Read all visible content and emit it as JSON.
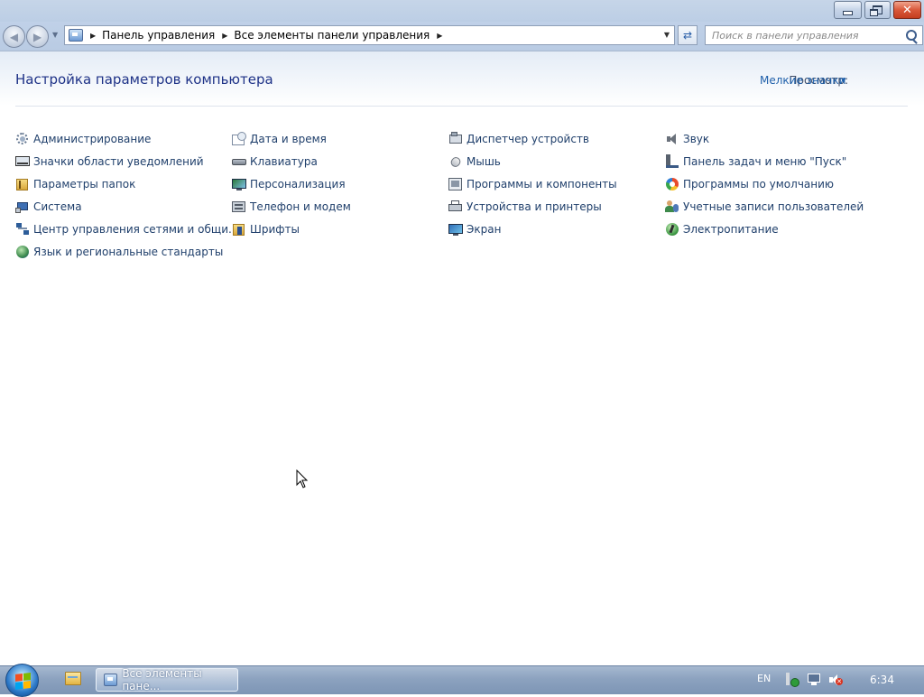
{
  "window": {
    "search_placeholder": "Поиск в панели управления",
    "breadcrumbs": [
      "Панель управления",
      "Все элементы панели управления"
    ]
  },
  "main": {
    "title": "Настройка параметров компьютера",
    "view_by_label": "Просмотр:",
    "view_by_value": "Мелкие значки"
  },
  "items": [
    {
      "label": "Администрирование",
      "icon": "admin-tools-icon"
    },
    {
      "label": "Значки области уведомлений",
      "icon": "notification-icons-icon"
    },
    {
      "label": "Параметры папок",
      "icon": "folder-options-icon"
    },
    {
      "label": "Система",
      "icon": "system-icon"
    },
    {
      "label": "Центр управления сетями и общи...",
      "icon": "network-center-icon"
    },
    {
      "label": "Язык и региональные стандарты",
      "icon": "region-language-icon"
    },
    {
      "label": "Дата и время",
      "icon": "date-time-icon"
    },
    {
      "label": "Клавиатура",
      "icon": "keyboard-icon"
    },
    {
      "label": "Персонализация",
      "icon": "personalization-icon"
    },
    {
      "label": "Телефон и модем",
      "icon": "phone-modem-icon"
    },
    {
      "label": "Шрифты",
      "icon": "fonts-icon"
    },
    {
      "label": "Диспетчер устройств",
      "icon": "device-manager-icon"
    },
    {
      "label": "Мышь",
      "icon": "mouse-icon"
    },
    {
      "label": "Программы и компоненты",
      "icon": "programs-features-icon"
    },
    {
      "label": "Устройства и принтеры",
      "icon": "devices-printers-icon"
    },
    {
      "label": "Экран",
      "icon": "display-icon"
    },
    {
      "label": "Звук",
      "icon": "sound-icon"
    },
    {
      "label": "Панель задач и меню \"Пуск\"",
      "icon": "taskbar-start-menu-icon"
    },
    {
      "label": "Программы по умолчанию",
      "icon": "default-programs-icon"
    },
    {
      "label": "Учетные записи пользователей",
      "icon": "user-accounts-icon"
    },
    {
      "label": "Электропитание",
      "icon": "power-options-icon"
    }
  ],
  "taskbar": {
    "task_label": "Все элементы пане...",
    "language": "EN",
    "time": "6:34"
  },
  "colors": {
    "link": "#1f3f6b",
    "title": "#1e3287",
    "accent": "#1e5faa"
  }
}
